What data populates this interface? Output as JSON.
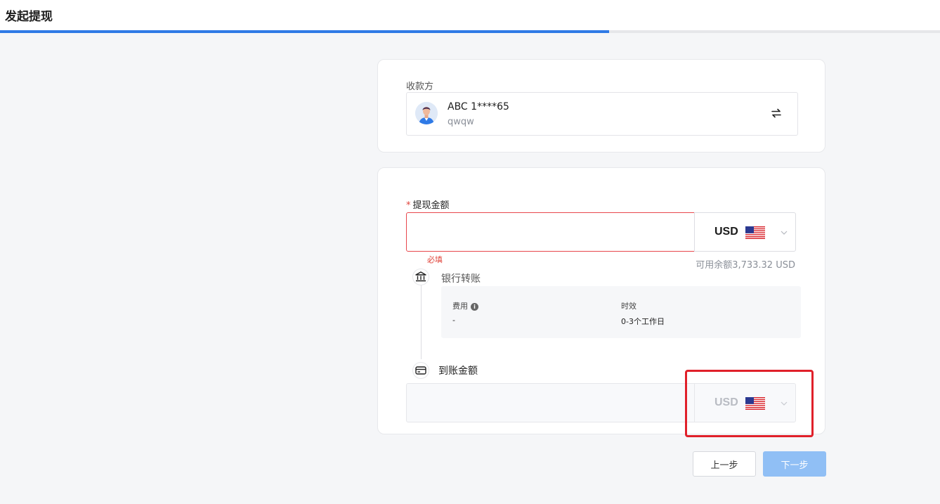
{
  "header": {
    "title": "发起提现",
    "progress_percent": 64.8
  },
  "payee": {
    "label": "收款方",
    "name": "ABC 1****65",
    "subtitle": "qwqw"
  },
  "withdraw": {
    "required_mark": "*",
    "amount_label": "提现金额",
    "amount_value": "",
    "currency": "USD",
    "error": "必填",
    "balance": "可用余额3,733.32 USD"
  },
  "method": {
    "label": "银行转账",
    "fee_label": "费用",
    "fee_value": "-",
    "time_label": "时效",
    "time_value": "0-3个工作日"
  },
  "arrival": {
    "label": "到账金额",
    "currency": "USD"
  },
  "buttons": {
    "prev": "上一步",
    "next": "下一步"
  },
  "colors": {
    "accent": "#2f7ae6",
    "error": "#e0433a",
    "highlight": "#e0202a",
    "next_button": "#90bff5"
  }
}
